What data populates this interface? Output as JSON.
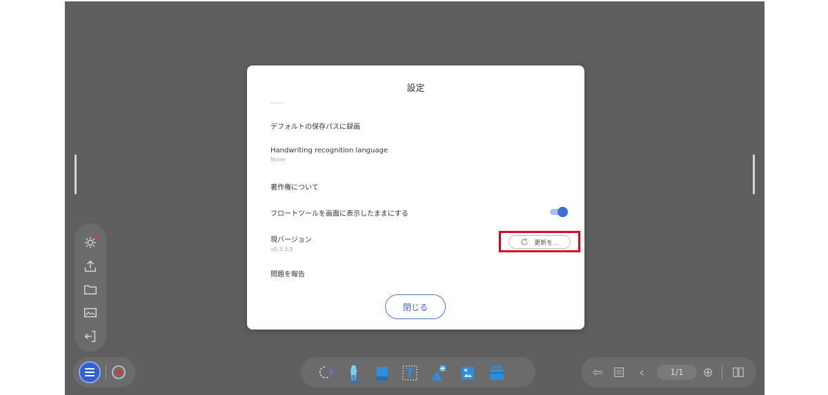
{
  "dialog": {
    "title": "設定",
    "items": [
      {
        "label": "デフォルトの保存パスに録画"
      },
      {
        "label": "Handwriting recognition language",
        "value": "None"
      },
      {
        "label": "著作権について"
      },
      {
        "label": "フロートツールを画面に表示したままにする",
        "toggle_on": true
      },
      {
        "label": "現バージョン",
        "value": "v0.3.3.5",
        "button_label": "更新を..."
      },
      {
        "label": "問題を報告"
      }
    ],
    "close_label": "閉じる"
  },
  "toolbar": {
    "page_indicator": "1/1"
  },
  "colors": {
    "accent": "#3d6fd8",
    "highlight": "#e0001b",
    "backdrop": "#5f5f5f"
  }
}
